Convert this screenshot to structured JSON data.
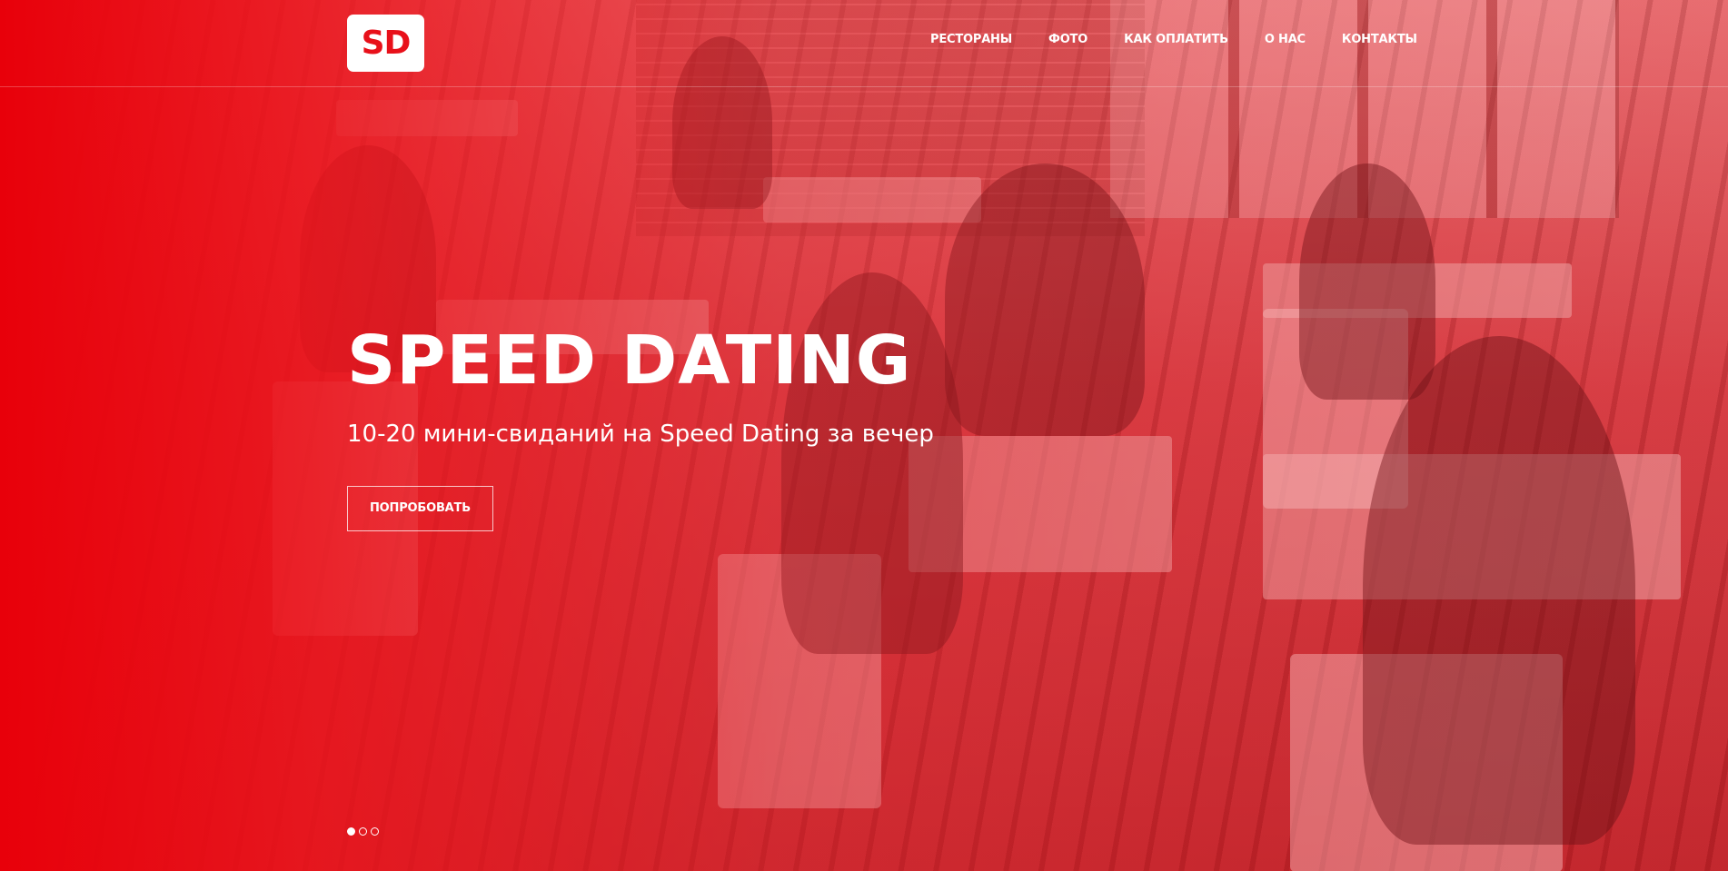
{
  "brand": {
    "logo_text": "SD"
  },
  "nav": {
    "items": [
      {
        "label": "РЕСТОРАНЫ"
      },
      {
        "label": "ФОТО"
      },
      {
        "label": "КАК ОПЛАТИТЬ"
      },
      {
        "label": "О НАС"
      },
      {
        "label": "КОНТАКТЫ"
      }
    ]
  },
  "hero": {
    "title": "SPEED DATING",
    "subtitle": "10-20 мини-свиданий на Speed Dating за вечер",
    "cta_label": "ПОПРОБОВАТЬ"
  },
  "slider": {
    "total": 3,
    "active_index": 0
  },
  "colors": {
    "accent": "#e8101a",
    "text": "#ffffff"
  }
}
